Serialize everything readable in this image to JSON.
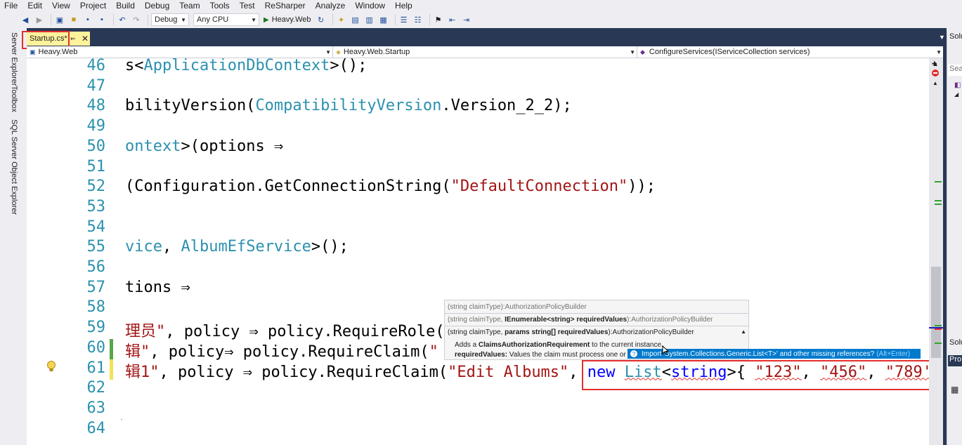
{
  "menu": [
    "File",
    "Edit",
    "View",
    "Project",
    "Build",
    "Debug",
    "Team",
    "Tools",
    "Test",
    "ReSharper",
    "Analyze",
    "Window",
    "Help"
  ],
  "toolbar": {
    "config": "Debug",
    "platform": "Any CPU",
    "run_target": "Heavy.Web"
  },
  "side_tabs": [
    "Server Explorer",
    "Toolbox",
    "SQL Server Object Explorer"
  ],
  "doc_tab": {
    "label": "Startup.cs*"
  },
  "navbar": {
    "project": "Heavy.Web",
    "type": "Heavy.Web.Startup",
    "member": "ConfigureServices(IServiceCollection services)"
  },
  "lines": [
    {
      "num": "46",
      "segs": [
        [
          "n",
          "s<"
        ],
        [
          "t",
          "ApplicationDbContext"
        ],
        [
          "n",
          ">();"
        ]
      ]
    },
    {
      "num": "47",
      "segs": []
    },
    {
      "num": "48",
      "segs": [
        [
          "n",
          "bilityVersion("
        ],
        [
          "t",
          "CompatibilityVersion"
        ],
        [
          "n",
          ".Version_2_2);"
        ]
      ]
    },
    {
      "num": "49",
      "segs": []
    },
    {
      "num": "50",
      "segs": [
        [
          "t",
          "ontext"
        ],
        [
          "n",
          ">(options ⇒"
        ]
      ]
    },
    {
      "num": "51",
      "segs": []
    },
    {
      "num": "52",
      "segs": [
        [
          "n",
          "(Configuration.GetConnectionString("
        ],
        [
          "s",
          "\"DefaultConnection\""
        ],
        [
          "n",
          "));"
        ]
      ]
    },
    {
      "num": "53",
      "segs": []
    },
    {
      "num": "54",
      "segs": []
    },
    {
      "num": "55",
      "segs": [
        [
          "t",
          "vice"
        ],
        [
          "n",
          ", "
        ],
        [
          "t",
          "AlbumEfService"
        ],
        [
          "n",
          ">();"
        ]
      ]
    },
    {
      "num": "56",
      "segs": []
    },
    {
      "num": "57",
      "segs": [
        [
          "n",
          "tions ⇒"
        ]
      ]
    },
    {
      "num": "58",
      "segs": []
    },
    {
      "num": "59",
      "segs": [
        [
          "s",
          "理员\""
        ],
        [
          "n",
          ", policy ⇒ policy.RequireRole("
        ]
      ]
    },
    {
      "num": "60",
      "segs": [
        [
          "s",
          "辑\""
        ],
        [
          "n",
          ", policy⇒ policy.RequireClaim("
        ],
        [
          "s",
          "\""
        ]
      ]
    },
    {
      "num": "61",
      "segs": [
        [
          "s",
          "辑1\""
        ],
        [
          "n",
          ", policy ⇒ policy.RequireClaim("
        ],
        [
          "s",
          "\"Edit Albums\""
        ],
        [
          "n",
          ", "
        ],
        [
          "k",
          "new"
        ],
        [
          "n",
          " "
        ],
        [
          "tq",
          "List"
        ],
        [
          "n",
          "<"
        ],
        [
          "kq",
          "string"
        ],
        [
          "n",
          ">{ "
        ],
        [
          "sq",
          "\"123\""
        ],
        [
          "n",
          ", "
        ],
        [
          "sq",
          "\"456\""
        ],
        [
          "n",
          ", "
        ],
        [
          "sq",
          "\"789'"
        ]
      ]
    },
    {
      "num": "62",
      "segs": []
    },
    {
      "num": "63",
      "segs": []
    },
    {
      "num": "64",
      "segs": []
    }
  ],
  "signature_popup": {
    "overload1": "(string claimType):AuthorizationPolicyBuilder",
    "overload2_pre": "(string claimType, ",
    "overload2_bold": "IEnumerable<string> requiredValues",
    "overload2_post": "):AuthorizationPolicyBuilder",
    "overload3_pre": "(string claimType, ",
    "overload3_bold": "params string[] requiredValues",
    "overload3_post": "):AuthorizationPolicyBuilder",
    "desc_pre": "Adds a ",
    "desc_bold": "ClaimsAuthorizationRequirement",
    "desc_post": " to the current instance.",
    "param_label": "requiredValues:",
    "param_text": " Values the claim must process one or"
  },
  "quickfix": {
    "text": "Import 'System.Collections.Generic.List<T>' and other missing references?",
    "shortcut": "(Alt+Enter)"
  },
  "right_panel": {
    "title1": "Solu",
    "search": "Sea",
    "title2": "Solu",
    "title3": "Pro"
  },
  "colors": {
    "accent": "#007acc",
    "highlight": "#e52e2e",
    "tab_active": "#fff29d"
  }
}
